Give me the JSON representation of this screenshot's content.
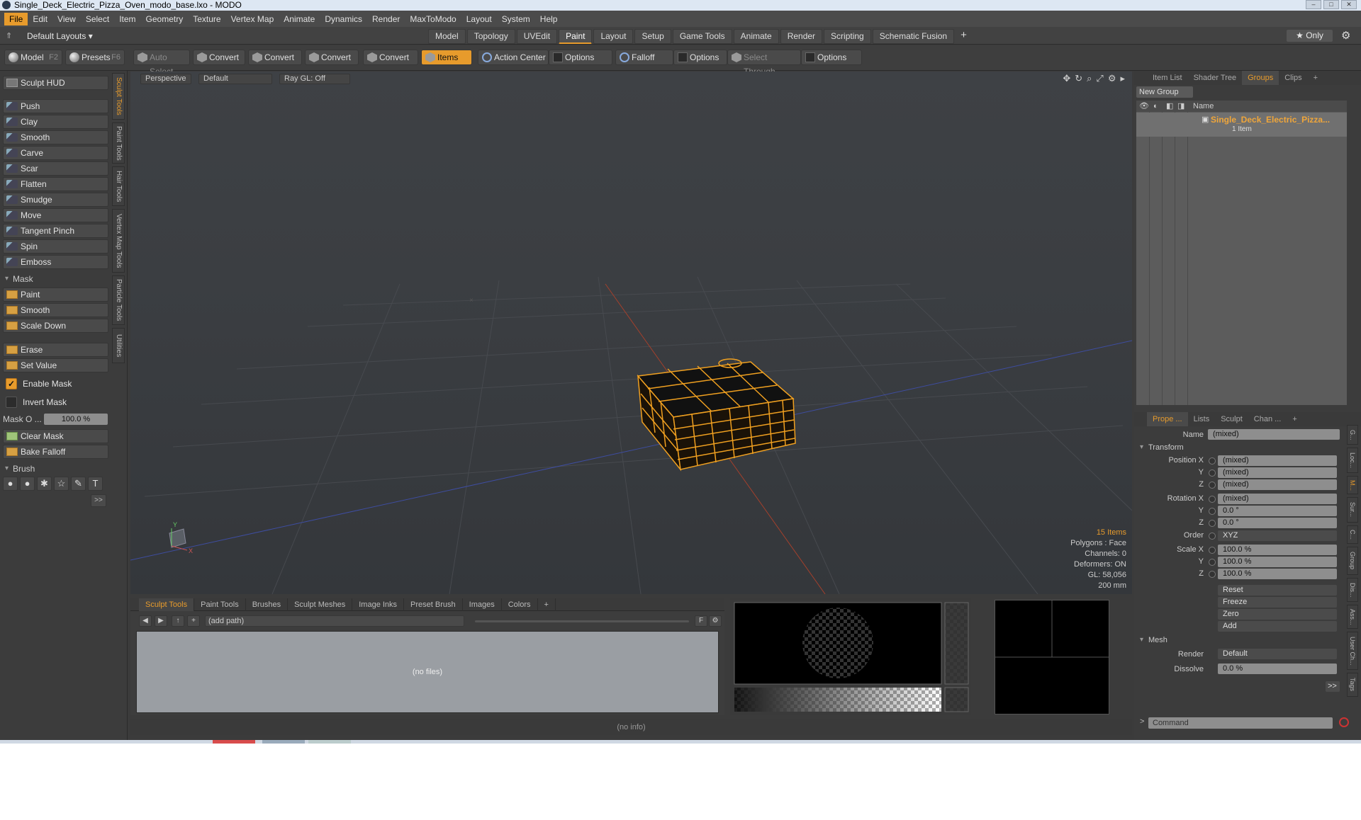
{
  "window": {
    "title": "Single_Deck_Electric_Pizza_Oven_modo_base.lxo - MODO",
    "buttons": [
      "–",
      "□",
      "✕"
    ]
  },
  "menu": [
    "File",
    "Edit",
    "View",
    "Select",
    "Item",
    "Geometry",
    "Texture",
    "Vertex Map",
    "Animate",
    "Dynamics",
    "Render",
    "MaxToModo",
    "Layout",
    "System",
    "Help"
  ],
  "layout": {
    "name": "Default Layouts ▾",
    "tabs": [
      "Model",
      "Topology",
      "UVEdit",
      "Paint",
      "Layout",
      "Setup",
      "Game Tools",
      "Animate",
      "Render",
      "Scripting",
      "Schematic Fusion"
    ],
    "active_tab": "Paint",
    "plus": "+",
    "only": "★  Only"
  },
  "toolbar": {
    "model": "Model",
    "model_key": "F2",
    "presets": "Presets",
    "presets_key": "F6",
    "auto_select": "Auto Select",
    "convert1": "Convert",
    "convert2": "Convert",
    "convert3": "Convert",
    "convert4": "Convert",
    "items": "Items",
    "action_center": "Action Center",
    "options1": "Options",
    "falloff": "Falloff",
    "options2": "Options",
    "select_through": "Select Through",
    "options3": "Options"
  },
  "left": {
    "sculpt_hud": "Sculpt HUD",
    "tools": [
      "Push",
      "Clay",
      "Smooth",
      "Carve",
      "Scar",
      "Flatten",
      "Smudge",
      "Move",
      "Tangent Pinch",
      "Spin",
      "Emboss"
    ],
    "mask_section": "Mask",
    "mask_tools": [
      "Paint",
      "Smooth",
      "Scale Down"
    ],
    "erase": "Erase",
    "set_value": "Set Value",
    "enable_mask": "Enable Mask",
    "invert_mask": "Invert Mask",
    "mask_opacity_label": "Mask O ...",
    "mask_opacity_value": "100.0 %",
    "clear_mask": "Clear Mask",
    "bake_falloff": "Bake Falloff",
    "brush_section": "Brush",
    "brush_icons": [
      "●",
      "●",
      "✱",
      "☆",
      "✎",
      "T"
    ],
    "more": ">>",
    "vtabs": [
      "Sculpt Tools",
      "Paint Tools",
      "Hair Tools",
      "Vertex Map Tools",
      "Particle Tools",
      "Utilities"
    ]
  },
  "viewport": {
    "labels": [
      "Perspective",
      "Default",
      "Ray GL: Off"
    ],
    "info": {
      "items": "15 Items",
      "polygons": "Polygons : Face",
      "channels": "Channels: 0",
      "deformers": "Deformers: ON",
      "gl": "GL: 58,056",
      "scale": "200 mm"
    },
    "axis_y": "Y",
    "axis_x": "X"
  },
  "bottom": {
    "tabs": [
      "Sculpt Tools",
      "Paint Tools",
      "Brushes",
      "Sculpt Meshes",
      "Image Inks",
      "Preset Brush",
      "Images",
      "Colors",
      "+"
    ],
    "active_tab": "Sculpt Tools",
    "path": "(add path)",
    "files": "(no files)",
    "status": "(no info)",
    "f_label": "F"
  },
  "right": {
    "tabs": [
      "Item List",
      "Shader Tree",
      "Groups",
      "Clips",
      "+"
    ],
    "active_tab": "Groups",
    "new_group": "New Group",
    "name_col": "Name",
    "group_name": "Single_Deck_Electric_Pizza...",
    "group_count": "1 Item",
    "prop_tabs": [
      "Prope ...",
      "Lists",
      "Sculpt",
      "Chan ...",
      "+"
    ],
    "name_label": "Name",
    "name_value": "(mixed)",
    "transform": "Transform",
    "pos_label": "Position X",
    "pos_x": "(mixed)",
    "pos_y": "(mixed)",
    "pos_z": "(mixed)",
    "rot_label": "Rotation X",
    "rot_x": "(mixed)",
    "rot_y": "0.0 °",
    "rot_z": "0.0 °",
    "order_label": "Order",
    "order": "XYZ",
    "scale_label": "Scale X",
    "scale_x": "100.0 %",
    "scale_y": "100.0 %",
    "scale_z": "100.0 %",
    "y": "Y",
    "z": "Z",
    "reset": "Reset",
    "freeze": "Freeze",
    "zero": "Zero",
    "add": "Add",
    "mesh": "Mesh",
    "render_label": "Render",
    "render": "Default",
    "dissolve_label": "Dissolve",
    "dissolve": "0.0 %",
    "more": ">>",
    "command": "Command",
    "vtabs": [
      "G...",
      "Loc...",
      "M...",
      "Sur...",
      "C...",
      "Group",
      "Dis...",
      "Ass...",
      "User Ch...",
      "Tags"
    ]
  },
  "colors": {
    "accent": "#e79b2c",
    "mesh": "#f0a020",
    "grid": "#4a4d52"
  }
}
